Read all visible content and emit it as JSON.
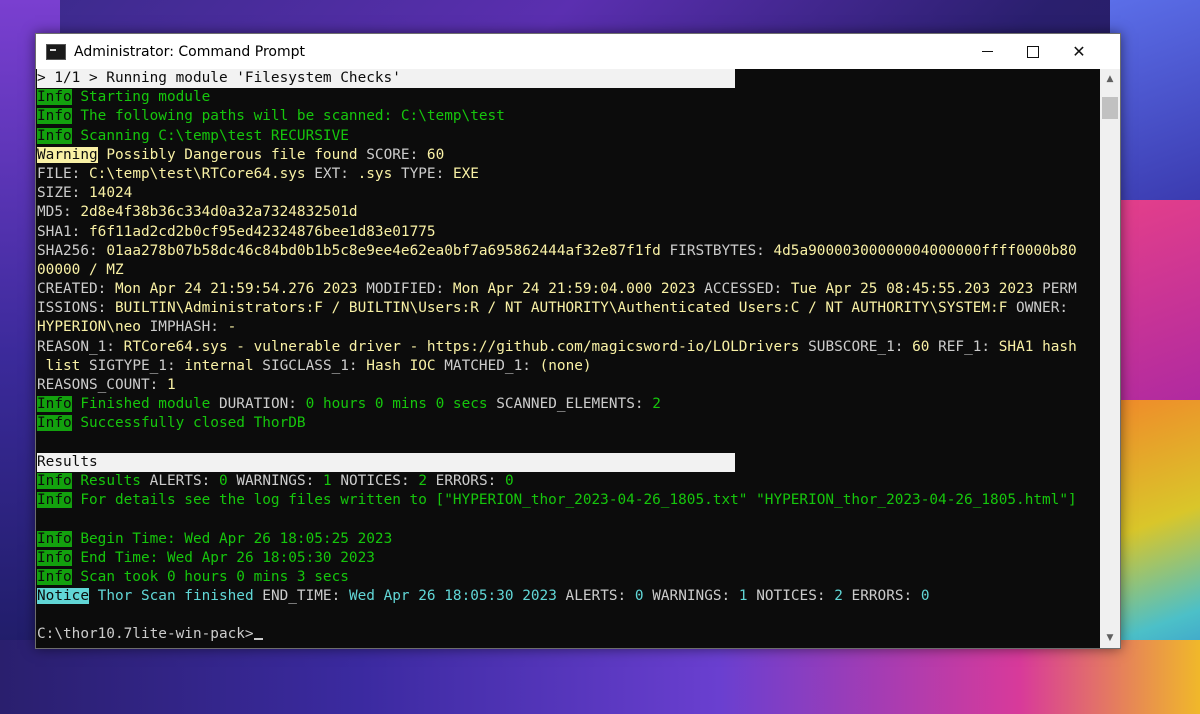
{
  "window": {
    "title": "Administrator: Command Prompt",
    "controls": {
      "minimize": "minimize",
      "maximize": "maximize",
      "close": "✕"
    }
  },
  "console": {
    "module_header": "> 1/1 > Running module 'Filesystem Checks'",
    "l_info1_tag": "Info",
    "l_info1_msg": "Starting module",
    "l_info2_tag": "Info",
    "l_info2_msg": "The following paths will be scanned: C:\\temp\\test",
    "l_info3_tag": "Info",
    "l_info3_msg": "Scanning C:\\temp\\test RECURSIVE",
    "warn_tag": "Warning",
    "warn_msg": "Possibly Dangerous file found",
    "warn_score_key": "SCORE:",
    "warn_score_val": "60",
    "file_key": "FILE:",
    "file_val": "C:\\temp\\test\\RTCore64.sys",
    "ext_key": "EXT:",
    "ext_val": ".sys",
    "type_key": "TYPE:",
    "type_val": "EXE",
    "size_key": "SIZE:",
    "size_val": "14024",
    "md5_key": "MD5:",
    "md5_val": "2d8e4f38b36c334d0a32a7324832501d",
    "sha1_key": "SHA1:",
    "sha1_val": "f6f11ad2cd2b0cf95ed42324876bee1d83e01775",
    "sha256_key": "SHA256:",
    "sha256_val": "01aa278b07b58dc46c84bd0b1b5c8e9ee4e62ea0bf7a695862444af32e87f1fd",
    "firstbytes_key": "FIRSTBYTES:",
    "firstbytes_val_a": "4d5a90000300000004000000ffff0000b80",
    "firstbytes_val_b": "00000 / MZ",
    "created_key": "CREATED:",
    "created_val": "Mon Apr 24 21:59:54.276 2023",
    "modified_key": "MODIFIED:",
    "modified_val": "Mon Apr 24 21:59:04.000 2023",
    "accessed_key": "ACCESSED:",
    "accessed_val": "Tue Apr 25 08:45:55.203 2023",
    "perm_key_a": "PERM",
    "perm_key_b": "ISSIONS:",
    "perm_val": "BUILTIN\\Administrators:F / BUILTIN\\Users:R / NT AUTHORITY\\Authenticated Users:C / NT AUTHORITY\\SYSTEM:F",
    "owner_key": "OWNER:",
    "owner_val": "HYPERION\\neo",
    "imphash_key": "IMPHASH:",
    "imphash_val": "-",
    "reason_key": "REASON_1:",
    "reason_val": "RTCore64.sys - vulnerable driver - https://github.com/magicsword-io/LOLDrivers",
    "subscore_key": "SUBSCORE_1:",
    "subscore_val": "60",
    "ref_key": "REF_1:",
    "ref_val_a": "SHA1 hash",
    "ref_val_b": " list",
    "sigtype_key": "SIGTYPE_1:",
    "sigtype_val": "internal",
    "sigclass_key": "SIGCLASS_1:",
    "sigclass_val": "Hash IOC",
    "matched_key": "MATCHED_1:",
    "matched_val": "(none)",
    "rc_key": "REASONS_COUNT:",
    "rc_val": "1",
    "fin_tag": "Info",
    "fin_msg": "Finished module",
    "dur_key": "DURATION:",
    "dur_val": "0 hours 0 mins 0 secs",
    "se_key": "SCANNED_ELEMENTS:",
    "se_val": "2",
    "closed_tag": "Info",
    "closed_msg": "Successfully closed ThorDB",
    "results_header": "Results",
    "res_tag": "Info",
    "res_msg": "Results",
    "alerts_key": "ALERTS:",
    "alerts_val": "0",
    "warnings_key": "WARNINGS:",
    "warnings_val": "1",
    "notices_key": "NOTICES:",
    "notices_val": "2",
    "errors_key": "ERRORS:",
    "errors_val": "0",
    "details_tag": "Info",
    "details_msg": "For details see the log files written to [\"HYPERION_thor_2023-04-26_1805.txt\" \"HYPERION_thor_2023-04-26_1805.html\"]",
    "begin_tag": "Info",
    "begin_msg": "Begin Time: Wed Apr 26 18:05:25 2023",
    "end_tag": "Info",
    "end_msg": "End Time: Wed Apr 26 18:05:30 2023",
    "took_tag": "Info",
    "took_msg": "Scan took 0 hours 0 mins 3 secs",
    "notice_tag": "Notice",
    "notice_msg": "Thor Scan finished",
    "endtime_key": "END_TIME:",
    "endtime_val": "Wed Apr 26 18:05:30 2023",
    "n_alerts_key": "ALERTS:",
    "n_alerts_val": "0",
    "n_warnings_key": "WARNINGS:",
    "n_warnings_val": "1",
    "n_notices_key": "NOTICES:",
    "n_notices_val": "2",
    "n_errors_key": "ERRORS:",
    "n_errors_val": "0",
    "prompt": "C:\\thor10.7lite-win-pack>"
  },
  "colors": {
    "console_bg": "#0c0c0c",
    "info_green": "#16c60c",
    "warning_yellow": "#f9f1a5",
    "notice_cyan": "#61d6d6"
  },
  "icons": [
    "cmd-app-icon",
    "minimize-icon",
    "maximize-icon",
    "close-icon",
    "scroll-up-icon",
    "scroll-down-icon"
  ]
}
